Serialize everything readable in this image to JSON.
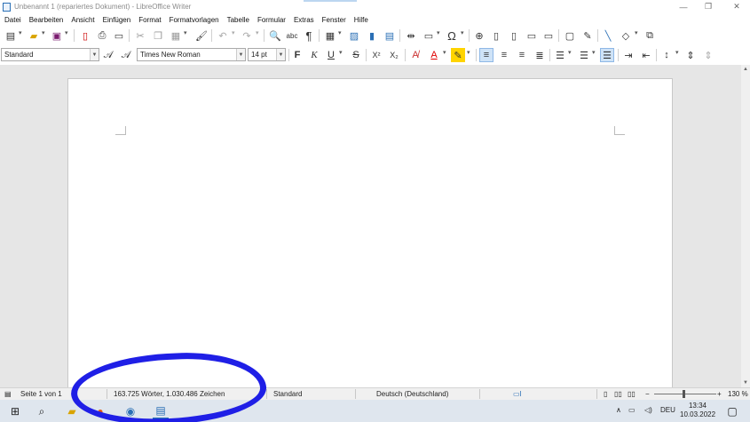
{
  "window": {
    "title": "Unbenannt 1 (repariertes Dokument) - LibreOffice Writer",
    "controls": {
      "minimize": "—",
      "maximize": "❐",
      "close": "✕"
    }
  },
  "menu": [
    "Datei",
    "Bearbeiten",
    "Ansicht",
    "Einfügen",
    "Format",
    "Formatvorlagen",
    "Tabelle",
    "Formular",
    "Extras",
    "Fenster",
    "Hilfe"
  ],
  "formatting": {
    "paragraph_style": "Standard",
    "font_name": "Times New Roman",
    "font_size": "14 pt",
    "bold": "F",
    "italic": "K",
    "underline": "U",
    "strike": "S",
    "superscript": "X²",
    "subscript": "X₂",
    "font_color_glyph": "A",
    "font_color": "#e00000",
    "highlight_color": "#ffd400",
    "paragraph_symbol": "¶",
    "abc": "abc"
  },
  "status": {
    "page": "Seite 1 von 1",
    "word_count": "163.725 Wörter, 1.030.486 Zeichen",
    "page_style": "Standard",
    "language": "Deutsch (Deutschland)",
    "zoom": "130 %",
    "zoom_minus": "−",
    "zoom_plus": "+"
  },
  "taskbar": {
    "language": "DEU",
    "time": "13:34",
    "date": "10.03.2022"
  },
  "colors": {
    "annotation": "#1f1fe6",
    "accent": "#2a6fb5"
  }
}
